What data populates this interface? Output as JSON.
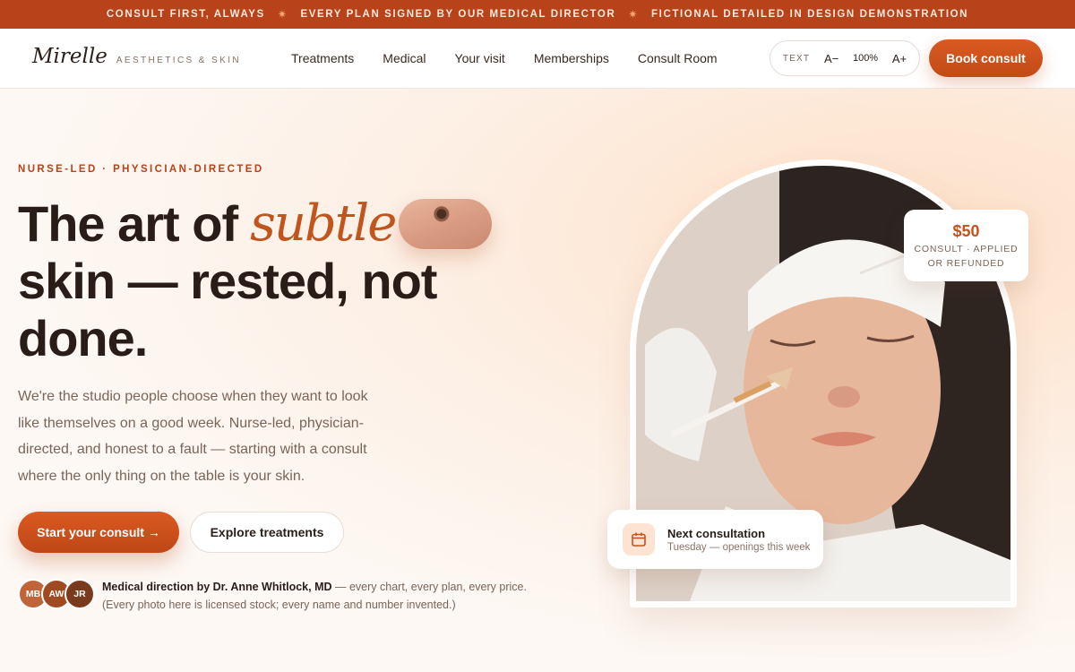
{
  "announcement": {
    "items": [
      "CONSULT FIRST, ALWAYS",
      "EVERY PLAN SIGNED BY OUR MEDICAL DIRECTOR",
      "FICTIONAL DETAILED IN DESIGN DEMONSTRATION"
    ],
    "separator": "✷"
  },
  "nav": {
    "logo_name": "Mirelle",
    "logo_sub": "AESTHETICS & SKIN",
    "links": [
      "Treatments",
      "Medical",
      "Your visit",
      "Memberships",
      "Consult Room"
    ],
    "text_label": "TEXT",
    "decrease": "A−",
    "zoom": "100%",
    "increase": "A+",
    "book": "Book consult"
  },
  "hero": {
    "eyebrow": "NURSE-LED · PHYSICIAN-DIRECTED",
    "headline_part1": "The art of",
    "headline_accent": "subtle",
    "headline_line2": "skin — rested, not",
    "headline_line3": "done.",
    "paragraph": "We're the studio people choose when they want to look like themselves on a good week. Nurse-led, physician-directed, and honest to a fault — starting with a consult where the only thing on the table is your skin.",
    "cta_primary": "Start your consult →",
    "cta_secondary": "Explore treatments",
    "avatars": [
      {
        "initials": "MB",
        "color": "#c0653a"
      },
      {
        "initials": "AW",
        "color": "#a04a22"
      },
      {
        "initials": "JR",
        "color": "#7a3a1c"
      }
    ],
    "proof_bold": "Medical direction by Dr. Anne Whitlock, MD",
    "proof_rest": " — every chart, every plan, every price.",
    "proof_note": "(Every photo here is licensed stock; every name and number invented.)"
  },
  "price_card": {
    "price": "$50",
    "line1": "CONSULT · APPLIED",
    "line2": "OR REFUNDED"
  },
  "next_card": {
    "title": "Next consultation",
    "subtitle": "Tuesday — openings this week"
  },
  "colors": {
    "brand": "#b8421a",
    "accent": "#c2541d",
    "cta": "#d95a22"
  }
}
